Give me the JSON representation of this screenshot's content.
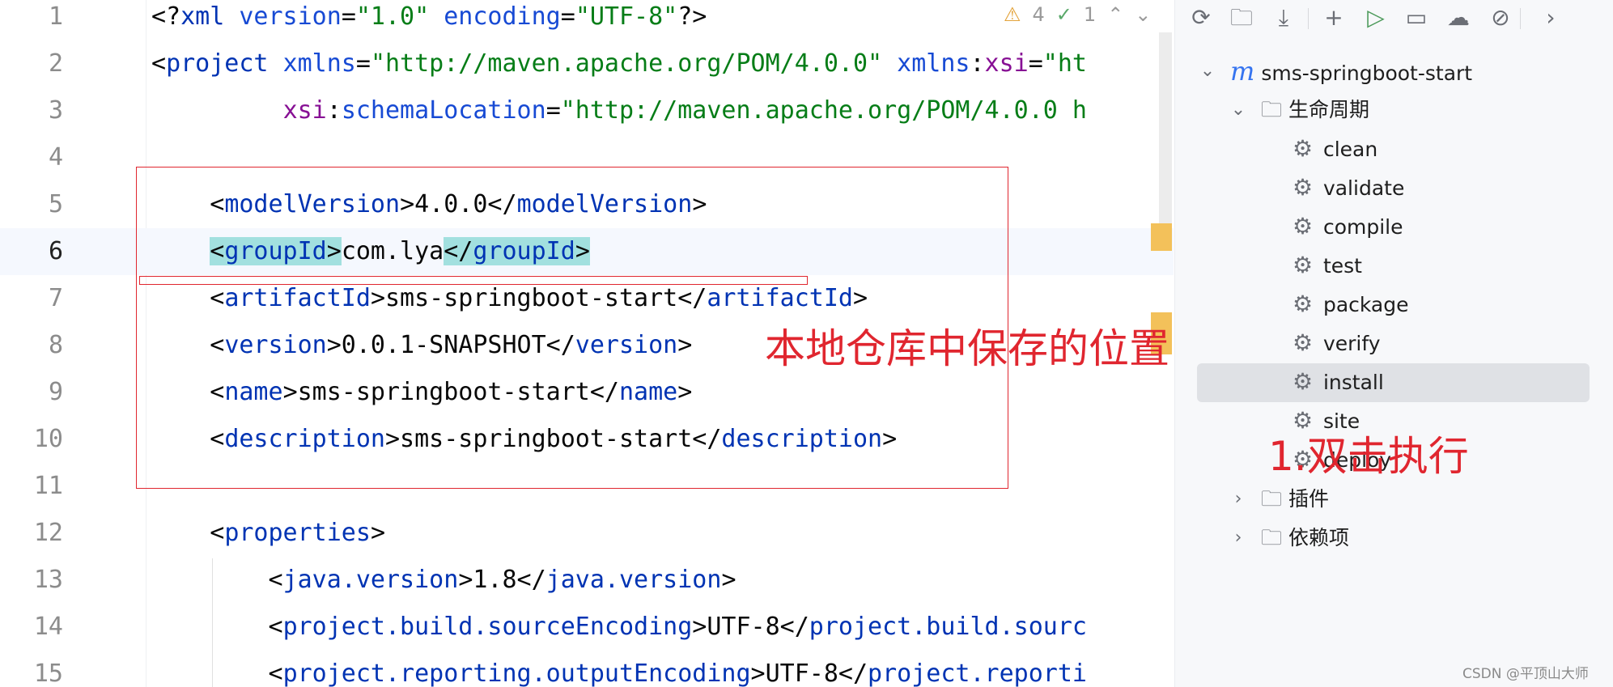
{
  "editor": {
    "lines": [
      {
        "n": "1",
        "tokens": [
          [
            "p",
            "<?"
          ],
          [
            "t",
            "xml "
          ],
          [
            "a",
            "version"
          ],
          [
            "p",
            "="
          ],
          [
            "v",
            "\"1.0\" "
          ],
          [
            "a",
            "encoding"
          ],
          [
            "p",
            "="
          ],
          [
            "v",
            "\"UTF-8\""
          ],
          [
            "p",
            "?>"
          ]
        ]
      },
      {
        "n": "2",
        "tokens": [
          [
            "p",
            "<"
          ],
          [
            "t",
            "project "
          ],
          [
            "a",
            "xmlns"
          ],
          [
            "p",
            "="
          ],
          [
            "v",
            "\"http://maven.apache.org/POM/4.0.0\" "
          ],
          [
            "a",
            "xmlns"
          ],
          [
            "p",
            ":"
          ],
          [
            "ns",
            "xsi"
          ],
          [
            "p",
            "="
          ],
          [
            "v",
            "\"ht"
          ]
        ]
      },
      {
        "n": "3",
        "tokens": [
          [
            "p",
            "         "
          ],
          [
            "ns",
            "xsi"
          ],
          [
            "p",
            ":"
          ],
          [
            "a",
            "schemaLocation"
          ],
          [
            "p",
            "="
          ],
          [
            "v",
            "\"http://maven.apache.org/POM/4.0.0 h"
          ]
        ]
      },
      {
        "n": "4",
        "tokens": []
      },
      {
        "n": "5",
        "tokens": [
          [
            "p",
            "    <"
          ],
          [
            "t",
            "modelVersion"
          ],
          [
            "p",
            ">4.0.0</"
          ],
          [
            "t",
            "modelVersion"
          ],
          [
            "p",
            ">"
          ]
        ]
      },
      {
        "n": "6",
        "tokens": [
          [
            "p",
            "    "
          ],
          [
            "hl",
            "<"
          ],
          [
            "hlt",
            "groupId"
          ],
          [
            "hl",
            ">"
          ],
          [
            "p",
            "com.lya"
          ],
          [
            "hl",
            "</"
          ],
          [
            "hlt",
            "groupId"
          ],
          [
            "hl",
            ">"
          ]
        ]
      },
      {
        "n": "7",
        "tokens": [
          [
            "p",
            "    <"
          ],
          [
            "t",
            "artifactId"
          ],
          [
            "p",
            ">sms-springboot-start</"
          ],
          [
            "t",
            "artifactId"
          ],
          [
            "p",
            ">"
          ]
        ]
      },
      {
        "n": "8",
        "tokens": [
          [
            "p",
            "    <"
          ],
          [
            "t",
            "version"
          ],
          [
            "p",
            ">0.0.1-SNAPSHOT</"
          ],
          [
            "t",
            "version"
          ],
          [
            "p",
            ">"
          ]
        ]
      },
      {
        "n": "9",
        "tokens": [
          [
            "p",
            "    <"
          ],
          [
            "t",
            "name"
          ],
          [
            "p",
            ">sms-springboot-start</"
          ],
          [
            "t",
            "name"
          ],
          [
            "p",
            ">"
          ]
        ]
      },
      {
        "n": "10",
        "tokens": [
          [
            "p",
            "    <"
          ],
          [
            "t",
            "description"
          ],
          [
            "p",
            ">sms-springboot-start</"
          ],
          [
            "t",
            "description"
          ],
          [
            "p",
            ">"
          ]
        ]
      },
      {
        "n": "11",
        "tokens": []
      },
      {
        "n": "12",
        "tokens": [
          [
            "p",
            "    <"
          ],
          [
            "t",
            "properties"
          ],
          [
            "p",
            ">"
          ]
        ]
      },
      {
        "n": "13",
        "tokens": [
          [
            "p",
            "        <"
          ],
          [
            "t",
            "java.version"
          ],
          [
            "p",
            ">1.8</"
          ],
          [
            "t",
            "java.version"
          ],
          [
            "p",
            ">"
          ]
        ]
      },
      {
        "n": "14",
        "tokens": [
          [
            "p",
            "        <"
          ],
          [
            "t",
            "project.build.sourceEncoding"
          ],
          [
            "p",
            ">UTF-8</"
          ],
          [
            "t",
            "project.build.sourc"
          ]
        ]
      },
      {
        "n": "15",
        "tokens": [
          [
            "p",
            "        <"
          ],
          [
            "t",
            "project.reporting.outputEncoding"
          ],
          [
            "p",
            ">UTF-8</"
          ],
          [
            "t",
            "project.reporti"
          ]
        ]
      }
    ],
    "current_line": 6,
    "inspections": {
      "warnings": "4",
      "weak_warnings": "1",
      "warning_icon": "warning-triangle-icon",
      "check_icon": "double-check-icon"
    }
  },
  "annotations": {
    "note_repo": "本地仓库中保存的位置",
    "note_run": "1.双击执行",
    "color": "#e0262f"
  },
  "maven_panel": {
    "toolbar": [
      {
        "name": "reload-icon",
        "glyph": "⟳"
      },
      {
        "name": "generate-sources-icon",
        "glyph": "🗀"
      },
      {
        "name": "download-icon",
        "glyph": "⤓"
      },
      {
        "name": "add-icon",
        "glyph": "+"
      },
      {
        "name": "run-icon",
        "glyph": "▷"
      },
      {
        "name": "execute-goal-icon",
        "glyph": "▭"
      },
      {
        "name": "offline-mode-icon",
        "glyph": "☁"
      },
      {
        "name": "skip-tests-icon",
        "glyph": "⊘"
      },
      {
        "name": "more-chevron-icon",
        "glyph": "›"
      }
    ],
    "project": "sms-springboot-start",
    "lifecycle_label": "生命周期",
    "goals": [
      "clean",
      "validate",
      "compile",
      "test",
      "package",
      "verify",
      "install",
      "site",
      "deploy"
    ],
    "selected_goal": "install",
    "plugins_label": "插件",
    "dependencies_label": "依赖项"
  },
  "watermark": "CSDN @平顶山大师"
}
